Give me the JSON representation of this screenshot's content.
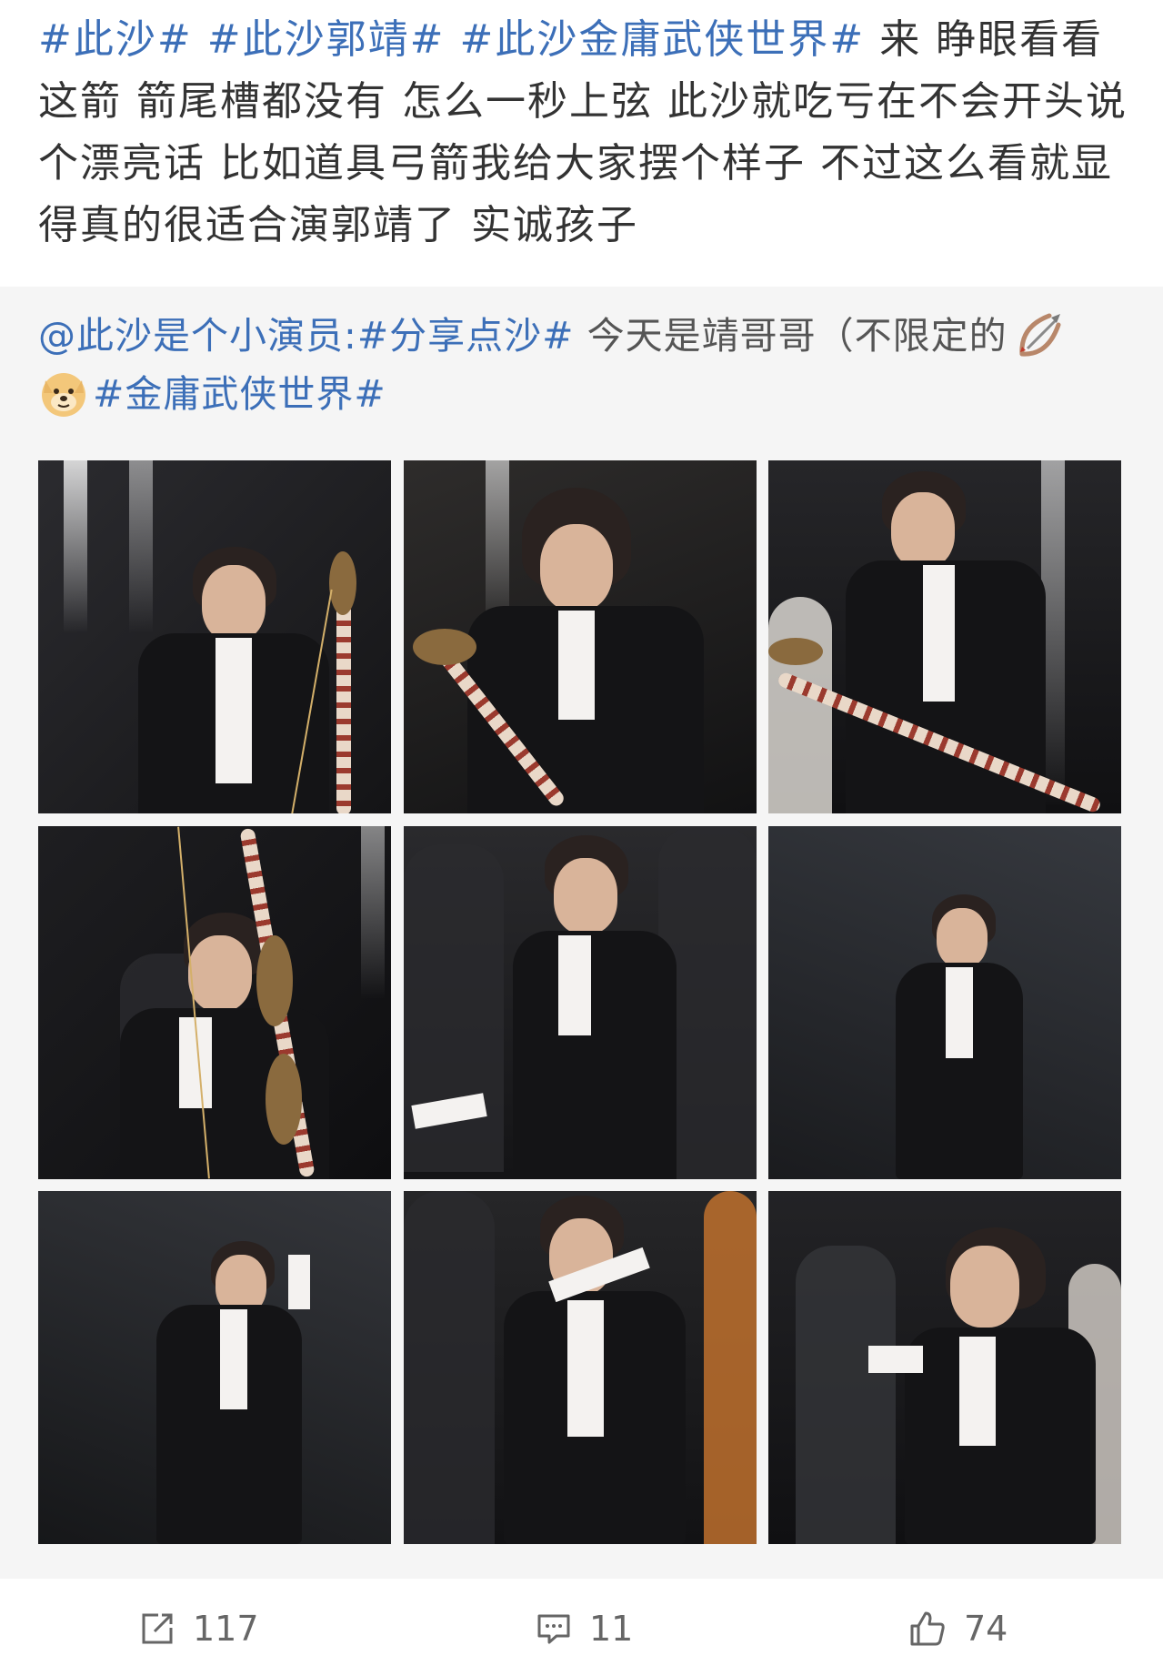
{
  "post": {
    "text_segments": [
      {
        "type": "tag",
        "text": "#此沙#"
      },
      {
        "type": "plain",
        "text": " "
      },
      {
        "type": "tag",
        "text": "#此沙郭靖#"
      },
      {
        "type": "plain",
        "text": " "
      },
      {
        "type": "tag",
        "text": "#此沙金庸武侠世界#"
      },
      {
        "type": "plain",
        "text": " 来 睁眼看看这箭 箭尾槽都没有 怎么一秒上弦  此沙就吃亏在不会开头说个漂亮话 比如道具弓箭我给大家摆个样子  不过这么看就显得真的很适合演郭靖了 实诚孩子"
      }
    ]
  },
  "repost": {
    "mention": "@此沙是个小演员:",
    "tag1": "#分享点沙#",
    "text": " 今天是靖哥哥（不限定的",
    "emoji1": "bow-and-arrow-emoji",
    "emoji2": "doge-emoji",
    "tag2": "#金庸武侠世界#"
  },
  "photos": [
    {
      "name": "photo-1",
      "alt": "holding bow beside microphone"
    },
    {
      "name": "photo-2",
      "alt": "looking down at bow"
    },
    {
      "name": "photo-3",
      "alt": "holding bow horizontally"
    },
    {
      "name": "photo-4",
      "alt": "drawing bow aiming"
    },
    {
      "name": "photo-5",
      "alt": "kung fu pose low stance"
    },
    {
      "name": "photo-6",
      "alt": "standing hand in pocket"
    },
    {
      "name": "photo-7",
      "alt": "hand to head pose"
    },
    {
      "name": "photo-8",
      "alt": "martial arts hand pose"
    },
    {
      "name": "photo-9",
      "alt": "laughing cupped hands"
    }
  ],
  "footer": {
    "repost_count": "117",
    "comment_count": "11",
    "like_count": "74"
  },
  "colors": {
    "tag": "#3c6fb8",
    "text": "#333333",
    "repost_bg": "#f5f5f5"
  }
}
